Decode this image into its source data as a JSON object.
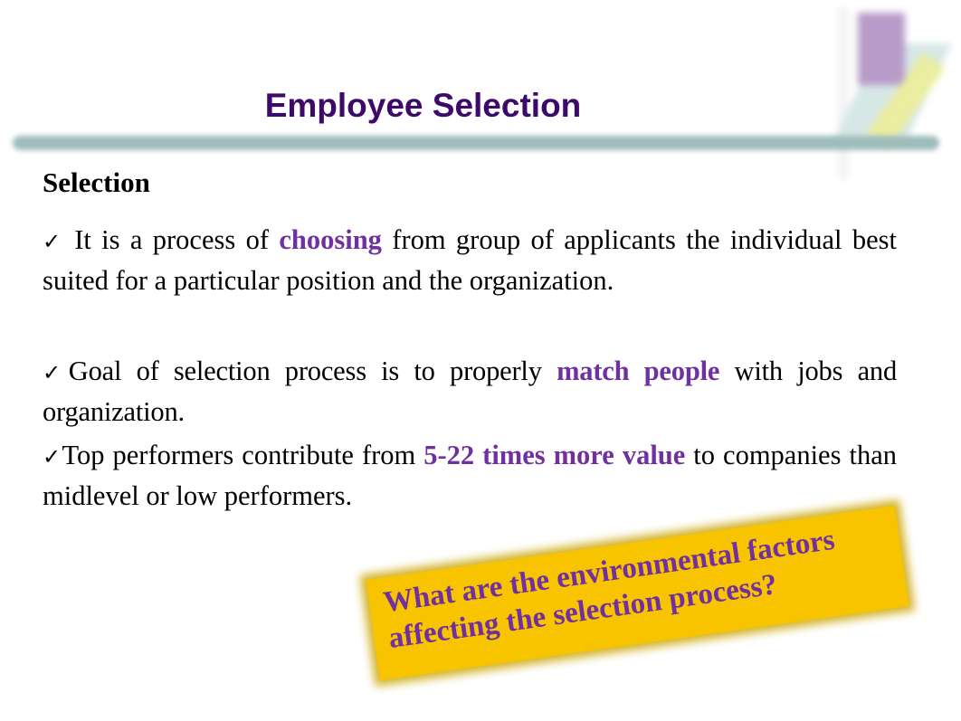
{
  "slide": {
    "title": "Employee Selection",
    "heading": "Selection",
    "bullet_icon": "check-mark-icon",
    "bullets": [
      {
        "check": "✓",
        "pre": " It is a process of ",
        "highlight": "choosing",
        "post": " from group of applicants the individual best suited for a particular position and the organization."
      },
      {
        "check": "✓",
        "pre": "Goal of selection process is to properly ",
        "highlight": "match people",
        "post": " with jobs and organization."
      },
      {
        "check": "✓",
        "pre": "Top performers contribute from ",
        "highlight": "5-22 times more value",
        "post": " to companies than midlevel or low performers."
      }
    ],
    "callout": {
      "text": "What are the environmental factors affecting the selection process?"
    },
    "colors": {
      "title": "#3d0a6a",
      "highlight": "#7030a0",
      "callout_bg": "#f8c400",
      "rule": "#9ebcbb"
    }
  }
}
